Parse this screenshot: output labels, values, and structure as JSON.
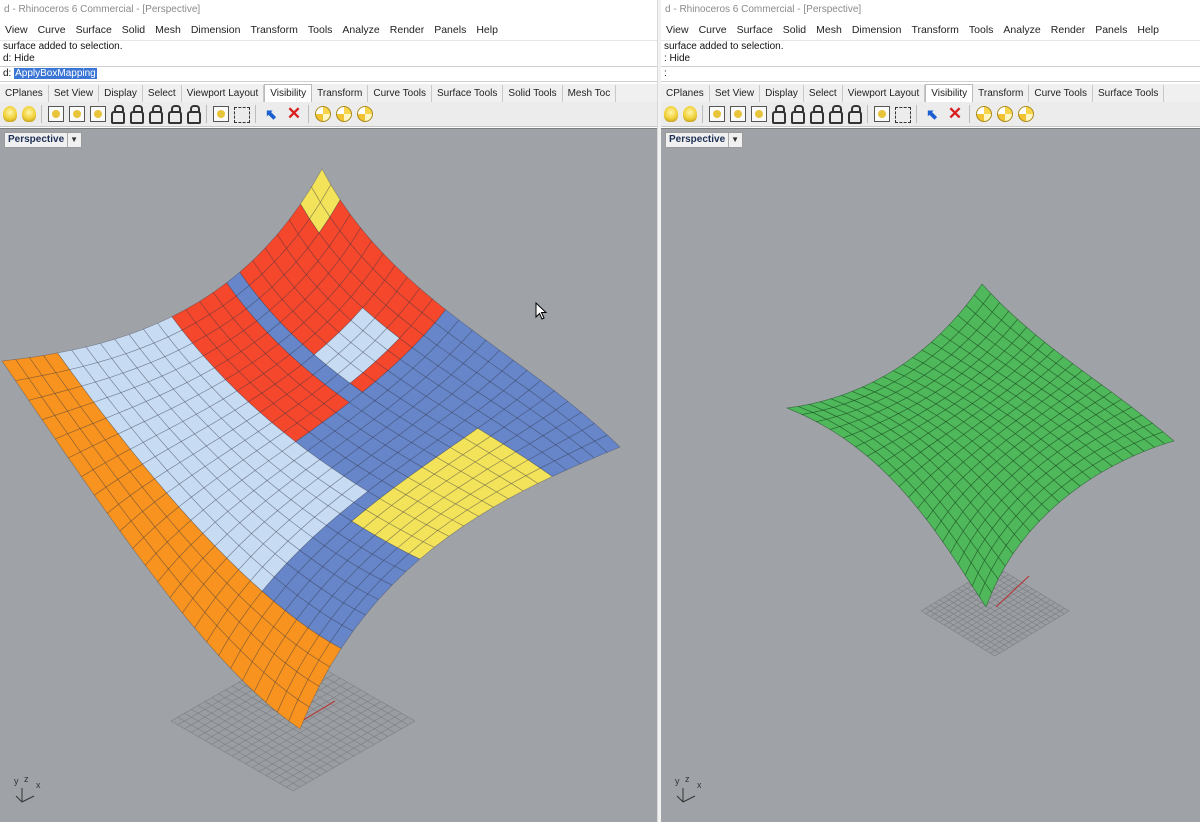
{
  "left": {
    "window_title": "d - Rhinoceros 6 Commercial - [Perspective]",
    "menu": [
      "View",
      "Curve",
      "Surface",
      "Solid",
      "Mesh",
      "Dimension",
      "Transform",
      "Tools",
      "Analyze",
      "Render",
      "Panels",
      "Help"
    ],
    "history": [
      "surface added to selection.",
      "d: Hide"
    ],
    "command_prompt": "d:",
    "command_text": "ApplyBoxMapping",
    "tabs": [
      "CPlanes",
      "Set View",
      "Display",
      "Select",
      "Viewport Layout",
      "Visibility",
      "Transform",
      "Curve Tools",
      "Surface Tools",
      "Solid Tools",
      "Mesh Toc"
    ],
    "active_tab": "Visibility",
    "viewport_title": "Perspective",
    "axis_labels": [
      "y",
      "z",
      "x"
    ]
  },
  "right": {
    "window_title": "d - Rhinoceros 6 Commercial - [Perspective]",
    "menu": [
      "View",
      "Curve",
      "Surface",
      "Solid",
      "Mesh",
      "Dimension",
      "Transform",
      "Tools",
      "Analyze",
      "Render",
      "Panels",
      "Help"
    ],
    "history": [
      "surface added to selection.",
      ": Hide"
    ],
    "command_prompt": ":",
    "command_text": "",
    "tabs": [
      "CPlanes",
      "Set View",
      "Display",
      "Select",
      "Viewport Layout",
      "Visibility",
      "Transform",
      "Curve Tools",
      "Surface Tools"
    ],
    "active_tab": "Visibility",
    "viewport_title": "Perspective",
    "axis_labels": [
      "y",
      "z",
      "x"
    ]
  },
  "colors": {
    "viewport_bg": "#9fa3a7",
    "grid_line": "#7c7f83",
    "surface_green": "#4fb85a",
    "mapping_orange": "#f7931e",
    "mapping_red": "#f4472c",
    "mapping_blue": "#6686c9",
    "mapping_lightblue": "#c7dcf3",
    "mapping_yellow": "#f3e35a",
    "selection_highlight": "#3b76d6"
  },
  "icons": {
    "toolbar": [
      "bulb-icon",
      "bulb-icon",
      "light-on-icon",
      "light-off-icon",
      "light-swap-icon",
      "lock-icon",
      "lock-icon",
      "unlock-icon",
      "unlock-icon",
      "lock-swap-icon",
      "select-lock-icon",
      "select-icon",
      "hide-points-icon",
      "delete-icon",
      "fan-icon",
      "fan-icon",
      "fan-icon"
    ],
    "viewport_dropdown": "chevron-down-icon",
    "cursor": "arrow-cursor-icon"
  }
}
